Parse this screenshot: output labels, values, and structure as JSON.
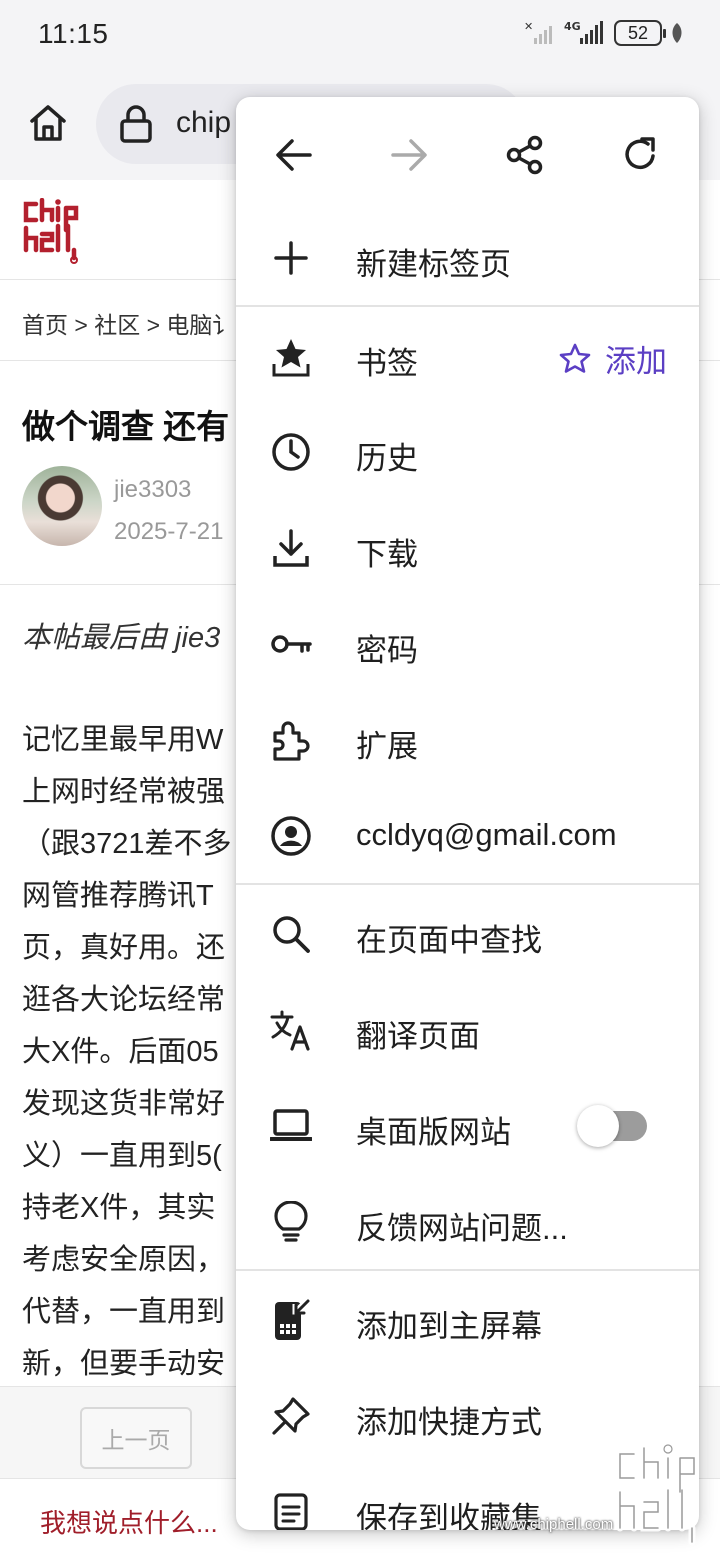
{
  "status_bar": {
    "time": "11:15",
    "battery": "52"
  },
  "browser": {
    "url": "chip"
  },
  "page": {
    "breadcrumb": "首页 > 社区 > 电脑讠",
    "title": "做个调查 还有",
    "author": "jie3303",
    "date": "2025-7-21",
    "edit_note": "本帖最后由 jie3",
    "body_lines": [
      "记忆里最早用W",
      "上网时经常被强",
      "（跟3721差不多",
      "网管推荐腾讯T",
      "页，真好用。还",
      "逛各大论坛经常",
      "大X件。后面05",
      "发现这货非常好",
      "义）一直用到5(",
      "持老X件，其实",
      "考虑安全原因，",
      "代替，一直用到",
      "新，但要手动安"
    ],
    "prev_page": "上一页",
    "reply_placeholder": "我想说点什么..."
  },
  "menu": {
    "new_tab": "新建标签页",
    "bookmarks": "书签",
    "bookmark_add": "添加",
    "history": "历史",
    "downloads": "下载",
    "passwords": "密码",
    "extensions": "扩展",
    "account": "ccldyq@gmail.com",
    "find_in_page": "在页面中查找",
    "translate": "翻译页面",
    "desktop_site": "桌面版网站",
    "desktop_site_enabled": false,
    "report_issue": "反馈网站问题...",
    "add_to_home": "添加到主屏幕",
    "add_shortcut": "添加快捷方式",
    "save_to_collection": "保存到收藏集"
  },
  "watermark": {
    "url": "www.chiphell.com"
  },
  "colors": {
    "accent": "#5b3fc4",
    "brand": "#a01e2a"
  }
}
